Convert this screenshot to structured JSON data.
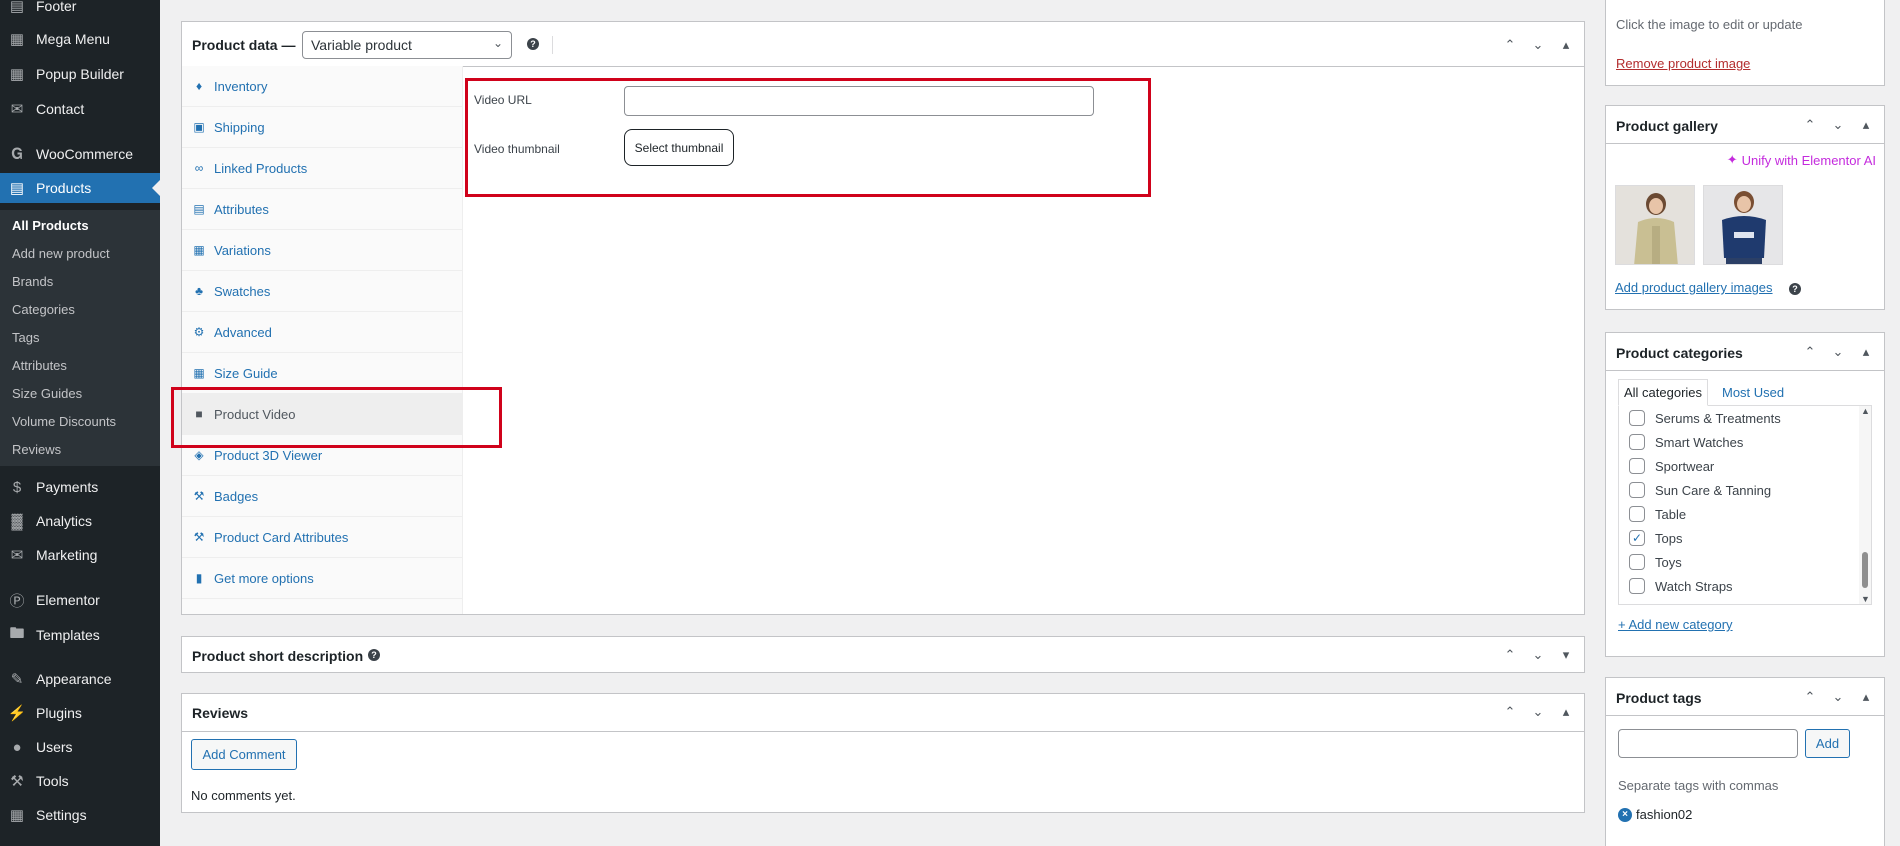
{
  "sidebar": {
    "items": [
      {
        "label": "Footer",
        "icon": "footer-icon"
      },
      {
        "label": "Mega Menu",
        "icon": "grid-icon"
      },
      {
        "label": "Popup Builder",
        "icon": "grid-icon"
      },
      {
        "label": "Contact",
        "icon": "mail-icon"
      },
      {
        "label": "WooCommerce",
        "icon": "woocommerce-icon"
      },
      {
        "label": "Products",
        "icon": "archive-icon"
      },
      {
        "label": "Payments",
        "icon": "dollar-icon"
      },
      {
        "label": "Analytics",
        "icon": "bar-chart-icon"
      },
      {
        "label": "Marketing",
        "icon": "megaphone-icon"
      },
      {
        "label": "Elementor",
        "icon": "elementor-icon"
      },
      {
        "label": "Templates",
        "icon": "folder-icon"
      },
      {
        "label": "Appearance",
        "icon": "brush-icon"
      },
      {
        "label": "Plugins",
        "icon": "plug-icon"
      },
      {
        "label": "Users",
        "icon": "user-icon"
      },
      {
        "label": "Tools",
        "icon": "wrench-icon"
      },
      {
        "label": "Settings",
        "icon": "settings-icon"
      }
    ],
    "submenu": [
      "All Products",
      "Add new product",
      "Brands",
      "Categories",
      "Tags",
      "Attributes",
      "Size Guides",
      "Volume Discounts",
      "Reviews"
    ]
  },
  "product_data": {
    "title": "Product data —",
    "type_select": "Variable product",
    "tabs": [
      {
        "label": "Inventory",
        "icon": "tag-icon"
      },
      {
        "label": "Shipping",
        "icon": "truck-icon"
      },
      {
        "label": "Linked Products",
        "icon": "link-icon"
      },
      {
        "label": "Attributes",
        "icon": "list-icon"
      },
      {
        "label": "Variations",
        "icon": "grid-icon"
      },
      {
        "label": "Swatches",
        "icon": "swatches-icon"
      },
      {
        "label": "Advanced",
        "icon": "gear-icon"
      },
      {
        "label": "Size Guide",
        "icon": "table-icon"
      },
      {
        "label": "Product Video",
        "icon": "video-icon"
      },
      {
        "label": "Product 3D Viewer",
        "icon": "cube-icon"
      },
      {
        "label": "Badges",
        "icon": "wrench-icon"
      },
      {
        "label": "Product Card Attributes",
        "icon": "wrench-icon"
      },
      {
        "label": "Get more options",
        "icon": "plugin-icon"
      }
    ],
    "video_url_label": "Video URL",
    "video_url_value": "",
    "video_thumbnail_label": "Video thumbnail",
    "select_thumbnail_button": "Select thumbnail"
  },
  "short_description": {
    "title": "Product short description"
  },
  "reviews": {
    "title": "Reviews",
    "add_comment_button": "Add Comment",
    "empty_text": "No comments yet."
  },
  "product_image": {
    "hint": "Click the image to edit or update",
    "remove_link": "Remove product image"
  },
  "product_gallery": {
    "title": "Product gallery",
    "unify_link": "Unify with Elementor AI",
    "add_link": "Add product gallery images",
    "images": [
      {
        "alt": "beige cardigan model",
        "icon": "photo-icon"
      },
      {
        "alt": "navy t-shirt model",
        "icon": "photo-icon"
      }
    ]
  },
  "product_categories": {
    "title": "Product categories",
    "tabs": [
      "All categories",
      "Most Used"
    ],
    "items": [
      {
        "label": "Serums & Treatments",
        "checked": false
      },
      {
        "label": "Smart Watches",
        "checked": false
      },
      {
        "label": "Sportwear",
        "checked": false
      },
      {
        "label": "Sun Care & Tanning",
        "checked": false
      },
      {
        "label": "Table",
        "checked": false
      },
      {
        "label": "Tops",
        "checked": true
      },
      {
        "label": "Toys",
        "checked": false
      },
      {
        "label": "Watch Straps",
        "checked": false
      }
    ],
    "add_link": "+ Add new category"
  },
  "product_tags": {
    "title": "Product tags",
    "input_value": "",
    "add_button": "Add",
    "hint": "Separate tags with commas",
    "tags": [
      "fashion02"
    ]
  },
  "colors": {
    "sidebar_bg": "#1d2327",
    "accent": "#2271b1",
    "highlight_box": "#d0021b",
    "ai_link": "#c42bdd"
  }
}
